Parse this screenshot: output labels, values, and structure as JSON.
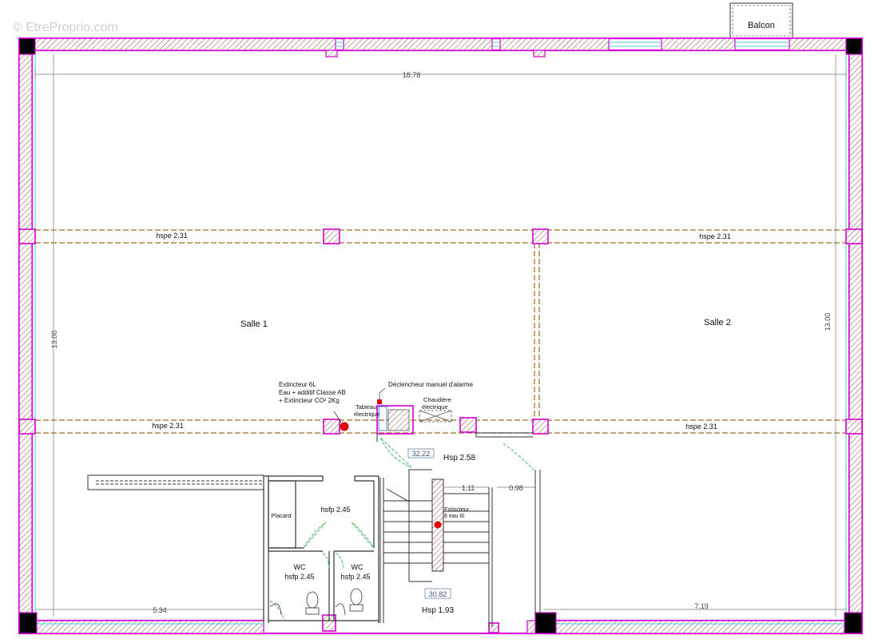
{
  "watermark": "© EtreProprio.com",
  "balcony_label": "Balcon",
  "dimensions": {
    "overall_width": "18.78",
    "left_height": "13.00",
    "right_height": "13.00",
    "bottom_left": "5.34",
    "bottom_right": "7.19",
    "stair_width": "1.11",
    "landing_width": "0.98"
  },
  "ceiling_heights": {
    "top_left": "hspe 2.31",
    "top_right": "hspe 2.31",
    "mid_left": "hspe 2.31",
    "mid_right": "hspe 2.31"
  },
  "rooms": {
    "salle1": "Salle 1",
    "salle2": "Salle 2",
    "hall_area": "32.22",
    "hall_height": "Hsp  2.58",
    "stair_area": "30.82",
    "stair_height": "Hsp  1.93",
    "sanitary_height": "hsfp  2.45",
    "placard": "Placard",
    "wc1_name": "WC",
    "wc1_height": "hsfp  2.45",
    "wc2_name": "WC",
    "wc2_height": "hsfp  2.45"
  },
  "equipment": {
    "extinguisher_line1": "Extincteur 6L",
    "extinguisher_line2": "Eau + additif Classe AB",
    "extinguisher_line3": "+ Extincteur CO² 2Kg",
    "alarm_label": "Déclencheur manuel d'alarme",
    "panel_line1": "Tableau",
    "panel_line2": "électrique",
    "boiler_line1": "Chaudière",
    "boiler_line2": "électrique",
    "stair_ext_line1": "Extincteur",
    "stair_ext_line2": "6 eau 6l"
  },
  "colors": {
    "wall": "#d400d4",
    "beam": "#a06a1c",
    "door": "#2aa84a",
    "window": "#55c8d8",
    "extinguisher": "#e00000"
  }
}
